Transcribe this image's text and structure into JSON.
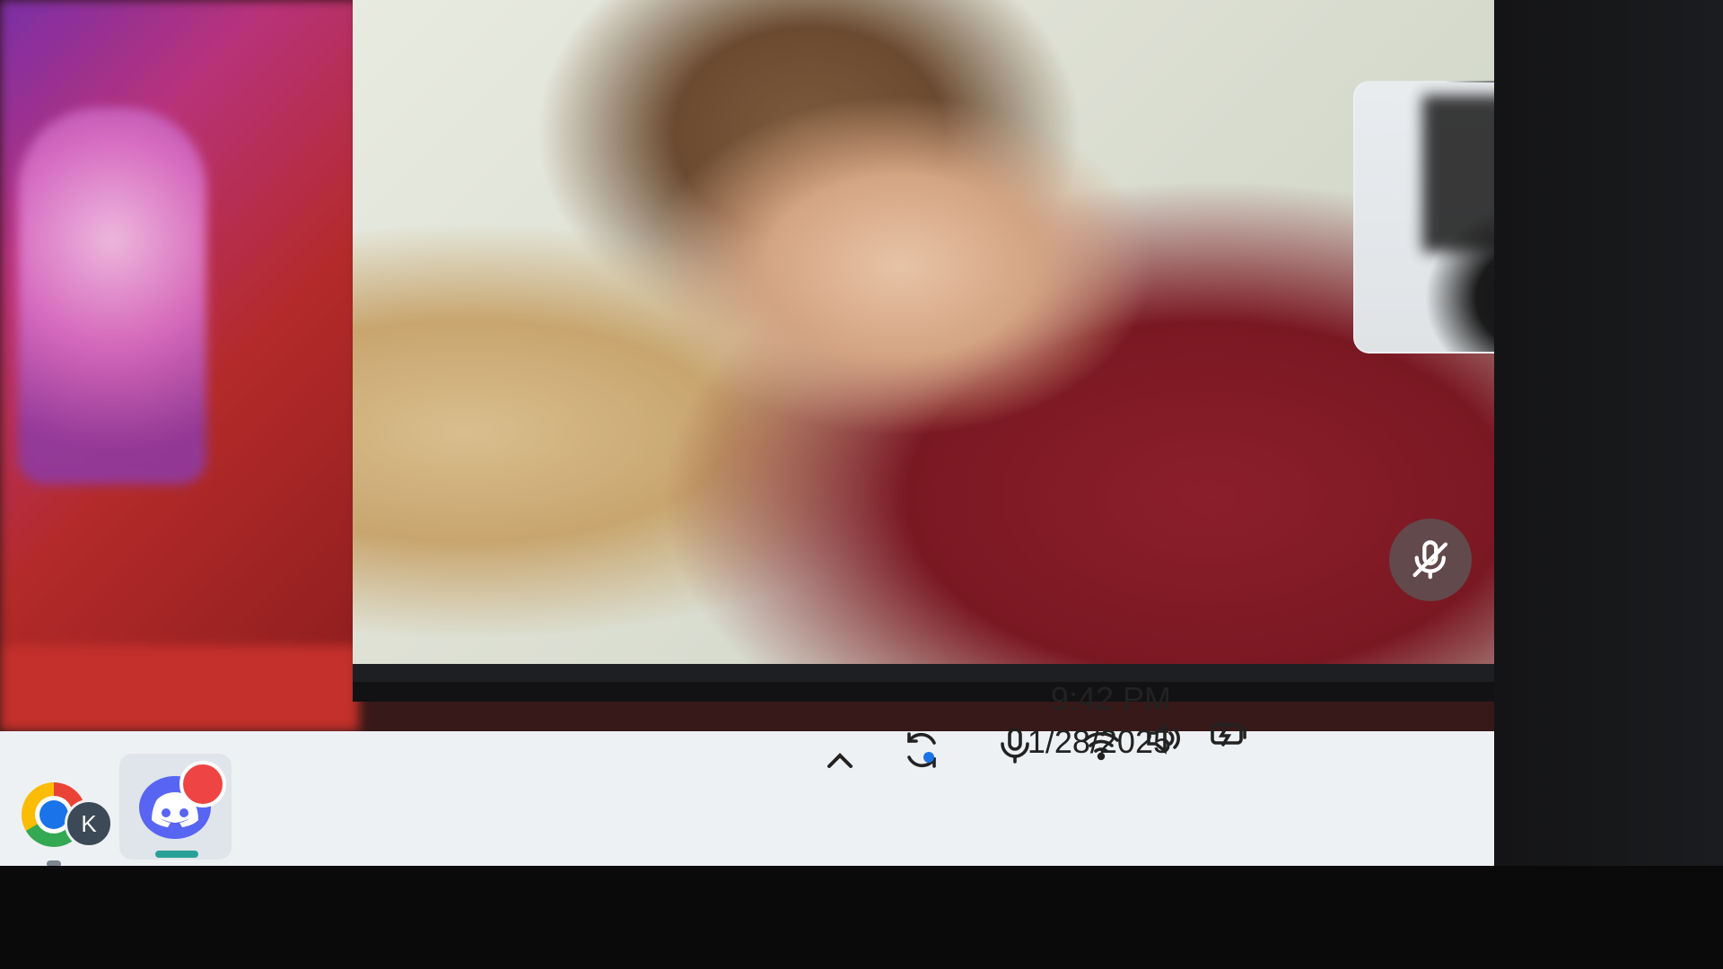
{
  "video_call": {
    "main_participant": {
      "muted": true,
      "mute_icon": "mic-off-icon"
    },
    "pip_participant": {
      "muted": true,
      "mute_icon": "mic-off-icon"
    }
  },
  "taskbar": {
    "apps": [
      {
        "name": "Google Chrome",
        "icon": "chrome-icon",
        "profile_badge": "K"
      },
      {
        "name": "Discord",
        "icon": "discord-icon",
        "notification_badge": true
      }
    ],
    "tray": {
      "icons": [
        "chevron-up-icon",
        "sync-icon",
        "microphone-icon",
        "wifi-icon",
        "volume-icon",
        "battery-charging-icon"
      ]
    },
    "clock": {
      "time": "9:42 PM",
      "date": "1/28/2025"
    }
  },
  "colors": {
    "taskbar_bg": "#eef1f4",
    "discord_blurple": "#5865f2",
    "notification_red": "#ef4444",
    "call_bg": "#1e1f22"
  }
}
